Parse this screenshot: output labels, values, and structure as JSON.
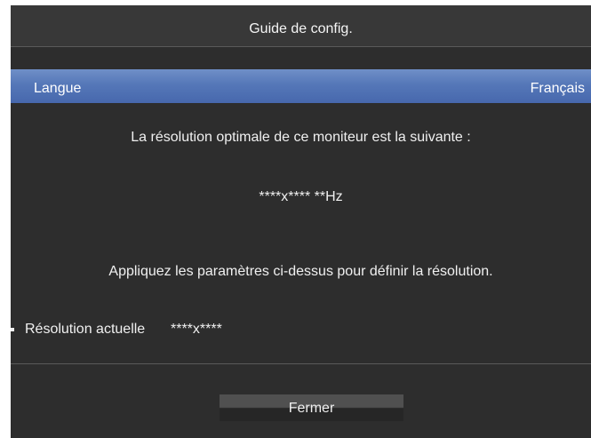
{
  "dialog": {
    "title": "Guide de config.",
    "language_label": "Langue",
    "language_value": "Français",
    "optimal_text": "La résolution optimale de ce moniteur est la suivante :",
    "optimal_resolution": "****x**** **Hz",
    "apply_text": "Appliquez les paramètres ci-dessus pour définir la résolution.",
    "current_label": "Résolution actuelle",
    "current_value": "****x****",
    "close_label": "Fermer"
  },
  "colors": {
    "background": "#2d2d2d",
    "title_bar": "#383838",
    "highlight": "#5577b8",
    "text": "#f0f0f0"
  }
}
